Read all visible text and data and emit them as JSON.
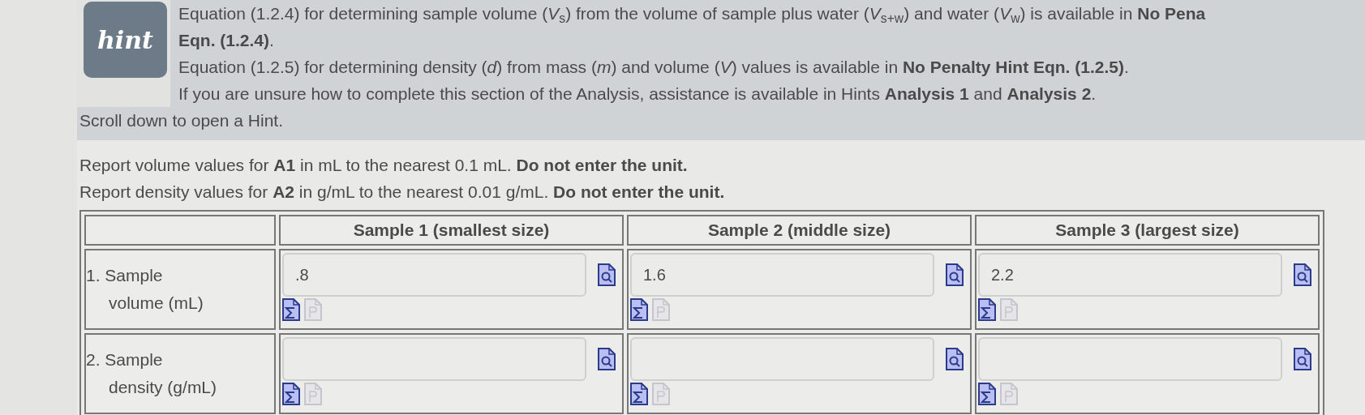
{
  "hint_badge": "hint",
  "hint_lines": [
    "Equation (1.2.4) for determining sample volume (*V*$_{s}$) from the volume of sample plus water (*V*$_{s+w}$) and water (*V*$_{w}$) is available in **No Pena**",
    "**Eqn. (1.2.4)**.",
    "Equation (1.2.5) for determining density (*d*) from mass (*m*) and volume (*V*) values is available in **No Penalty Hint Eqn. (1.2.5)**.",
    "If you are unsure how to complete this section of the Analysis, assistance is available in Hints **Analysis 1** and **Analysis 2**."
  ],
  "scroll_note": "Scroll down to open a Hint.",
  "instructions": [
    "Report volume values for **A1** in mL to the nearest 0.1 mL. **Do not enter the unit.**",
    "Report density values for **A2** in g/mL to the nearest 0.01 g/mL. **Do not enter the unit.**"
  ],
  "table": {
    "columns": [
      "Sample 1 (smallest size)",
      "Sample 2 (middle size)",
      "Sample 3 (largest size)"
    ],
    "rows": [
      {
        "label_lines": [
          "1. Sample",
          "volume (mL)"
        ],
        "cells": [
          {
            "value": ".8"
          },
          {
            "value": "1.6"
          },
          {
            "value": "2.2"
          }
        ]
      },
      {
        "label_lines": [
          "2. Sample",
          "density (g/mL)"
        ]
      }
    ]
  }
}
